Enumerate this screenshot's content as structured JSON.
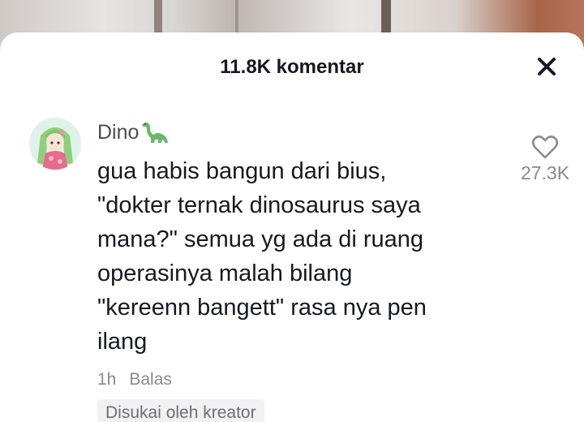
{
  "header": {
    "title": "11.8K komentar"
  },
  "comment": {
    "username": "Dino",
    "username_emoji_icon": "sauropod-dinosaur-icon",
    "text": "gua habis bangun dari bius,\n\"dokter ternak dinosaurus saya\nmana?\" semua yg ada di ruang\noperasinya malah bilang\n\"kereenn bangett\" rasa nya pen\nilang",
    "time": "1h",
    "reply_label": "Balas",
    "like_count": "27.3K",
    "creator_badge": "Disukai oleh kreator"
  },
  "icons": {
    "close": "close-icon",
    "like": "heart-outline-icon",
    "avatar": "anime-girl-avatar"
  },
  "colors": {
    "text_primary": "#161823",
    "text_secondary": "#8a8b91",
    "badge_bg": "#f1f1f2",
    "emoji_green": "#6db66a"
  }
}
